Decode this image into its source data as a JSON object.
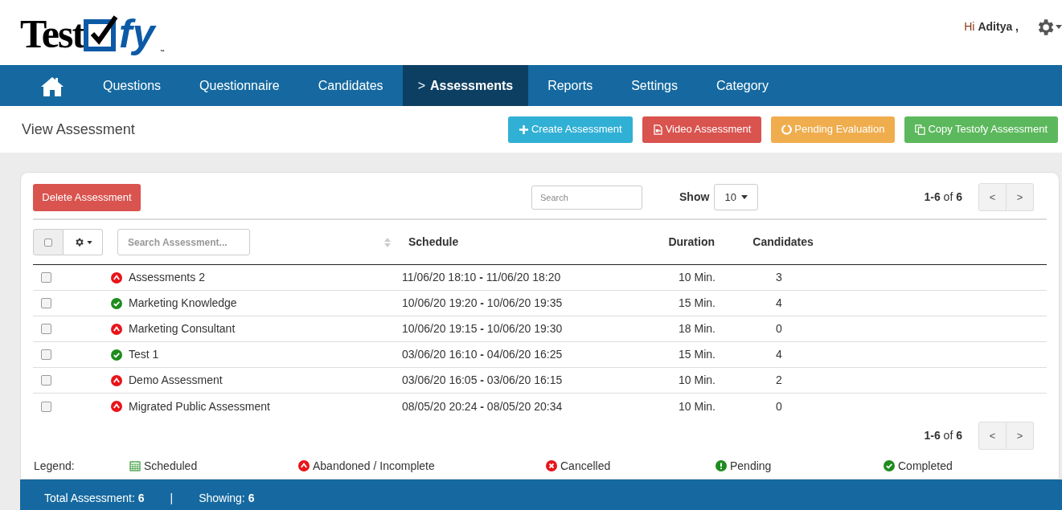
{
  "logo": {
    "word": "Test",
    "suffix": "fy",
    "trademark": "™"
  },
  "user": {
    "greeting": "Hi",
    "name": "Aditya ,"
  },
  "nav": [
    {
      "kind": "home",
      "selected": false
    },
    {
      "kind": "link",
      "label": "Questions",
      "selected": false
    },
    {
      "kind": "link",
      "label": "Questionnaire",
      "selected": false
    },
    {
      "kind": "link",
      "label": "Candidates",
      "selected": false
    },
    {
      "kind": "link",
      "label": "Assessments",
      "marker": ">",
      "selected": true
    },
    {
      "kind": "link",
      "label": "Reports",
      "selected": false
    },
    {
      "kind": "link",
      "label": "Settings",
      "selected": false
    },
    {
      "kind": "link",
      "label": "Category",
      "selected": false
    }
  ],
  "page_title": "View Assessment",
  "actions": [
    {
      "kind": "create",
      "label": "Create Assessment"
    },
    {
      "kind": "video",
      "label": "Video Assessment"
    },
    {
      "kind": "pending",
      "label": "Pending Evaluation"
    },
    {
      "kind": "copy",
      "label": "Copy Testofy Assessment"
    }
  ],
  "toolbar": {
    "delete_label": "Delete Assessment",
    "search": {
      "placeholder": "Search"
    },
    "show_label": "Show",
    "page_size": "10",
    "pagination": "**1-6** of **6**",
    "prev": "<",
    "next": ">"
  },
  "table": {
    "select_all": {
      "checked": false
    },
    "name_search": {
      "placeholder": "Search Assessment..."
    },
    "columns": [
      "Schedule",
      "Duration",
      "Candidates"
    ],
    "rows": [
      {
        "checked": false,
        "kind": "abandoned",
        "name": "Assessments 2",
        "schedule": "11/06/20 18:10 **-** 11/06/20 18:20",
        "duration": "10 Min.",
        "candidates": "3"
      },
      {
        "checked": false,
        "kind": "completed",
        "name": "Marketing Knowledge",
        "schedule": "10/06/20 19:20 **-** 10/06/20 19:35",
        "duration": "15 Min.",
        "candidates": "4"
      },
      {
        "checked": false,
        "kind": "abandoned",
        "name": "Marketing Consultant",
        "schedule": "10/06/20 19:15 **-** 10/06/20 19:30",
        "duration": "18 Min.",
        "candidates": "0"
      },
      {
        "checked": false,
        "kind": "completed",
        "name": "Test 1",
        "schedule": "03/06/20 16:10 **-** 04/06/20 16:25",
        "duration": "15 Min.",
        "candidates": "4"
      },
      {
        "checked": false,
        "kind": "abandoned",
        "name": "Demo Assessment",
        "schedule": "03/06/20 16:05 **-** 03/06/20 16:15",
        "duration": "10 Min.",
        "candidates": "2"
      },
      {
        "checked": false,
        "kind": "abandoned",
        "name": "Migrated Public Assessment",
        "schedule": "08/05/20 20:24 **-** 08/05/20 20:34",
        "duration": "10 Min.",
        "candidates": "0"
      }
    ]
  },
  "bottom_pagination": {
    "text": "**1-6** of **6**",
    "prev": "<",
    "next": ">"
  },
  "legend": {
    "label": "Legend:",
    "items": [
      {
        "kind": "scheduled",
        "label": "Scheduled"
      },
      {
        "kind": "abandoned",
        "label": "Abandoned / Incomplete"
      },
      {
        "kind": "cancelled",
        "label": "Cancelled"
      },
      {
        "kind": "pending",
        "label": "Pending"
      },
      {
        "kind": "completed",
        "label": "Completed"
      }
    ]
  },
  "status_bar": {
    "total": "Total Assessment: **6**",
    "separator": "|",
    "showing": "Showing: **6**"
  }
}
